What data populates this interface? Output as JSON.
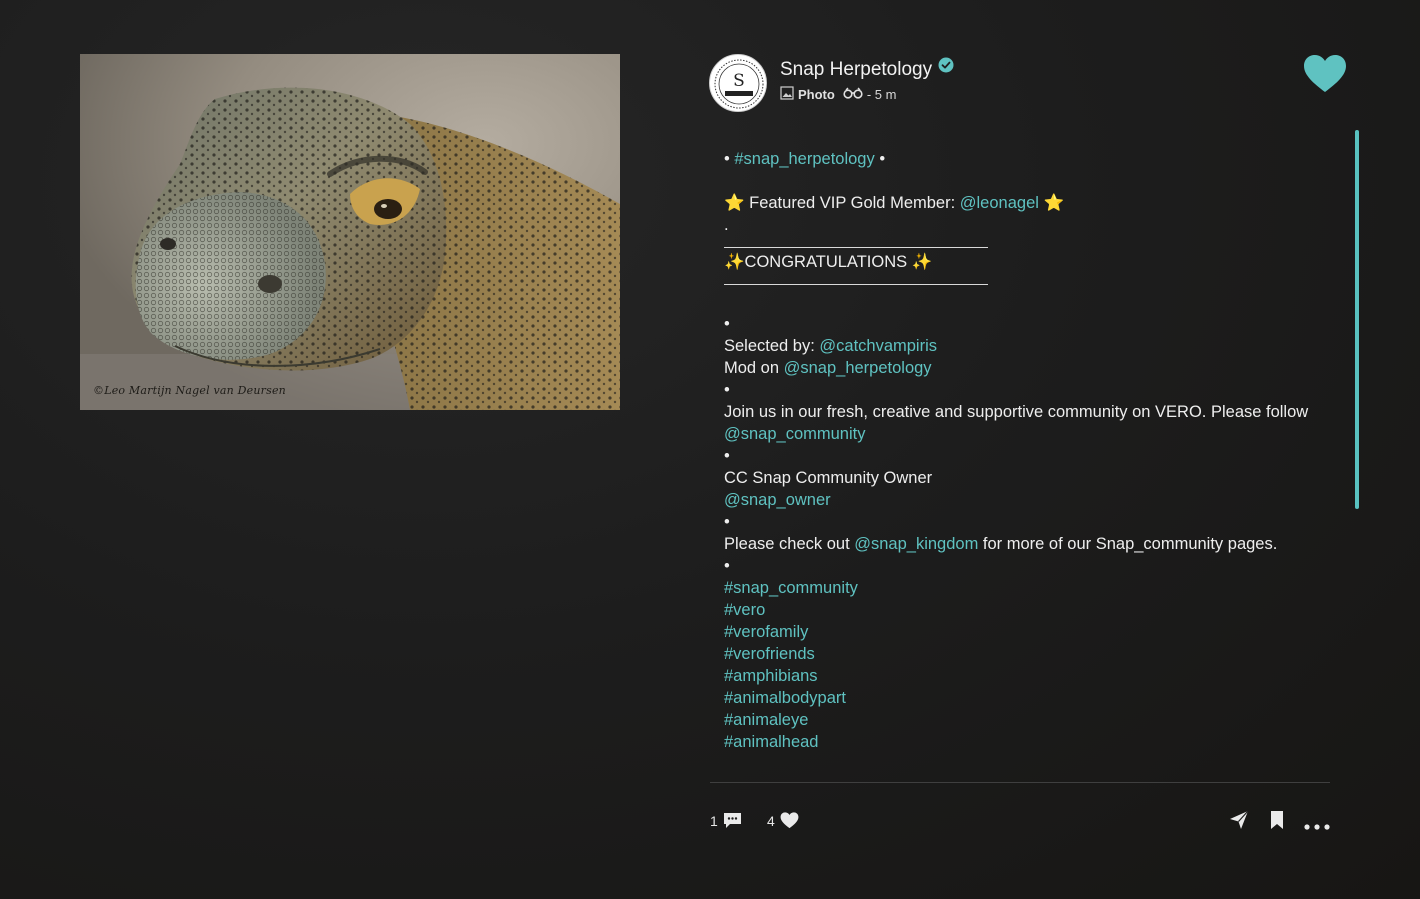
{
  "photo": {
    "alt": "Close-up of a Komodo dragon head",
    "watermark": "©Leo Martijn Nagel van Deursen"
  },
  "post": {
    "author": "Snap Herpetology",
    "post_type": "Photo",
    "time": "- 5 m",
    "accent_color": "#5fc2c1"
  },
  "caption": {
    "l1_pre": "• ",
    "l1_tag": "#snap_herpetology",
    "l1_post": " •",
    "l2_pre": "⭐ Featured VIP Gold Member: ",
    "l2_tag": "@leonagel",
    "l2_post": " ⭐",
    "l3": ".",
    "l4": "✨CONGRATULATIONS ✨",
    "l5": "•",
    "l6_pre": "Selected by: ",
    "l6_tag": "@catchvampiris",
    "l7_pre": "Mod on ",
    "l7_tag": "@snap_herpetology",
    "l8": "•",
    "l9_pre": "Join us in our fresh, creative and supportive community on VERO. Please follow ",
    "l9_tag": "@snap_community",
    "l10": "•",
    "l11": "CC Snap Community Owner",
    "l12_tag": "@snap_owner",
    "l13": "•",
    "l14_pre": "Please check out ",
    "l14_tag": "@snap_kingdom",
    "l14_post": "  for more of our Snap_community pages.",
    "l15": "•",
    "hashtags": [
      "#snap_community",
      "#vero",
      "#verofamily",
      "#verofriends",
      "#amphibians",
      "#animalbodypart",
      "#animaleye",
      "#animalhead"
    ]
  },
  "footer": {
    "comments_count": "1",
    "likes_count": "4"
  }
}
